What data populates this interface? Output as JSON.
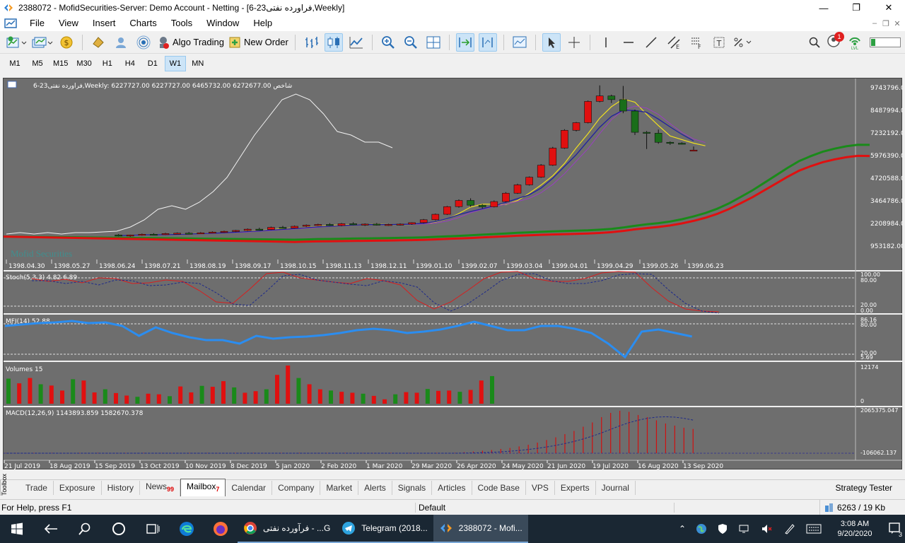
{
  "window": {
    "title": "2388072 - MofidSecurities-Server: Demo Account - Netting - [فراورده نفتی23-6,Weekly]"
  },
  "menu": [
    "File",
    "View",
    "Insert",
    "Charts",
    "Tools",
    "Window",
    "Help"
  ],
  "toolbar": {
    "algo_trading": "Algo Trading",
    "new_order": "New Order",
    "notifications": "1"
  },
  "timeframes": {
    "items": [
      "M1",
      "M5",
      "M15",
      "M30",
      "H1",
      "H4",
      "D1",
      "W1",
      "MN"
    ],
    "selected": "W1"
  },
  "chart": {
    "header": "فراورده نفتی23-6,Weekly:  6227727.00 6227727.00 6465732.00 6272677.00  شاخص",
    "watermark": "Mofid Securities",
    "main_prices": [
      "9743796.00",
      "8487994.00",
      "7232192.00",
      "5976390.00",
      "4720588.00",
      "3464786.00",
      "2208984.00",
      "953182.00"
    ],
    "main_dates": [
      "1398.04.30",
      "1398.05.27",
      "1398.06.24",
      "1398.07.21",
      "1398.08.19",
      "1398.09.17",
      "1398.10.15",
      "1398.11.13",
      "1398.12.11",
      "1399.01.10",
      "1399.02.07",
      "1399.03.04",
      "1399.04.01",
      "1399.04.29",
      "1399.05.26",
      "1399.06.23"
    ],
    "stoch_label": "Stoch(5,3,3) 4.82 6.89",
    "stoch_levels": [
      "100.00",
      "80.00",
      "20.00",
      "0.00"
    ],
    "mfi_label": "MFI(14) 52.88",
    "mfi_levels": [
      "86.16",
      "80.00",
      "20.00",
      "5.69"
    ],
    "vol_label": "Volumes 15",
    "vol_levels": [
      "12174",
      "0"
    ],
    "macd_label": "MACD(12,26,9) 1143893.859 1582670.378",
    "macd_levels": [
      "2065375.047",
      "-106062.137"
    ],
    "bottom_dates": [
      "21 Jul 2019",
      "18 Aug 2019",
      "15 Sep 2019",
      "13 Oct 2019",
      "10 Nov 2019",
      "8 Dec 2019",
      "5 Jan 2020",
      "2 Feb 2020",
      "1 Mar 2020",
      "29 Mar 2020",
      "26 Apr 2020",
      "24 May 2020",
      "21 Jun 2020",
      "19 Jul 2020",
      "16 Aug 2020",
      "13 Sep 2020"
    ]
  },
  "chart_data": {
    "type": "candlestick",
    "price_range": [
      953182,
      9743796
    ],
    "candles": [
      {
        "o": 1600000,
        "h": 1650000,
        "l": 1520000,
        "c": 1560000
      },
      {
        "o": 1560000,
        "h": 1620000,
        "l": 1500000,
        "c": 1600000
      },
      {
        "o": 1600000,
        "h": 1680000,
        "l": 1560000,
        "c": 1640000
      },
      {
        "o": 1640000,
        "h": 1700000,
        "l": 1600000,
        "c": 1620000
      },
      {
        "o": 1620000,
        "h": 1720000,
        "l": 1600000,
        "c": 1680000
      },
      {
        "o": 1680000,
        "h": 1740000,
        "l": 1650000,
        "c": 1700000
      },
      {
        "o": 1700000,
        "h": 1760000,
        "l": 1660000,
        "c": 1690000
      },
      {
        "o": 1690000,
        "h": 1760000,
        "l": 1660000,
        "c": 1720000
      },
      {
        "o": 1720000,
        "h": 1800000,
        "l": 1700000,
        "c": 1760000
      },
      {
        "o": 1760000,
        "h": 1840000,
        "l": 1720000,
        "c": 1800000
      },
      {
        "o": 1800000,
        "h": 1880000,
        "l": 1760000,
        "c": 1850000
      },
      {
        "o": 1850000,
        "h": 1960000,
        "l": 1820000,
        "c": 1920000
      },
      {
        "o": 1920000,
        "h": 2000000,
        "l": 1880000,
        "c": 1900000
      },
      {
        "o": 1900000,
        "h": 2060000,
        "l": 1880000,
        "c": 2020000
      },
      {
        "o": 2020000,
        "h": 2100000,
        "l": 1960000,
        "c": 1980000
      },
      {
        "o": 1980000,
        "h": 2120000,
        "l": 1960000,
        "c": 2080000
      },
      {
        "o": 2080000,
        "h": 2180000,
        "l": 2040000,
        "c": 2140000
      },
      {
        "o": 2140000,
        "h": 2220000,
        "l": 2100000,
        "c": 2180000
      },
      {
        "o": 2180000,
        "h": 2250000,
        "l": 2100000,
        "c": 2120000
      },
      {
        "o": 2120000,
        "h": 2260000,
        "l": 2080000,
        "c": 2220000
      },
      {
        "o": 2220000,
        "h": 2300000,
        "l": 2140000,
        "c": 2160000
      },
      {
        "o": 2160000,
        "h": 2240000,
        "l": 2100000,
        "c": 2200000
      },
      {
        "o": 2200000,
        "h": 2260000,
        "l": 2120000,
        "c": 2160000
      },
      {
        "o": 2160000,
        "h": 2220000,
        "l": 2100000,
        "c": 2180000
      },
      {
        "o": 2180000,
        "h": 2240000,
        "l": 2120000,
        "c": 2200000
      },
      {
        "o": 2200000,
        "h": 2300000,
        "l": 2160000,
        "c": 2280000
      },
      {
        "o": 2280000,
        "h": 2480000,
        "l": 2240000,
        "c": 2440000
      },
      {
        "o": 2440000,
        "h": 2780000,
        "l": 2400000,
        "c": 2740000
      },
      {
        "o": 2740000,
        "h": 3200000,
        "l": 2700000,
        "c": 3160000
      },
      {
        "o": 3160000,
        "h": 3560000,
        "l": 3100000,
        "c": 3500000
      },
      {
        "o": 3500000,
        "h": 3620000,
        "l": 3150000,
        "c": 3240000
      },
      {
        "o": 3240000,
        "h": 3300000,
        "l": 3060000,
        "c": 3150000
      },
      {
        "o": 3150000,
        "h": 3500000,
        "l": 3120000,
        "c": 3440000
      },
      {
        "o": 3440000,
        "h": 3960000,
        "l": 3400000,
        "c": 3900000
      },
      {
        "o": 3900000,
        "h": 4420000,
        "l": 3860000,
        "c": 4360000
      },
      {
        "o": 4360000,
        "h": 4820000,
        "l": 4320000,
        "c": 4780000
      },
      {
        "o": 4780000,
        "h": 5500000,
        "l": 4740000,
        "c": 5440000
      },
      {
        "o": 5440000,
        "h": 6450000,
        "l": 5400000,
        "c": 6380000
      },
      {
        "o": 6380000,
        "h": 7420000,
        "l": 6340000,
        "c": 7360000
      },
      {
        "o": 7360000,
        "h": 7820000,
        "l": 7300000,
        "c": 7780000
      },
      {
        "o": 7780000,
        "h": 9000000,
        "l": 7740000,
        "c": 8950000
      },
      {
        "o": 8950000,
        "h": 9830000,
        "l": 8900000,
        "c": 9250000
      },
      {
        "o": 9250000,
        "h": 9320000,
        "l": 8860000,
        "c": 9050000
      },
      {
        "o": 9050000,
        "h": 9800000,
        "l": 8300000,
        "c": 8420000
      },
      {
        "o": 8420000,
        "h": 8500000,
        "l": 7100000,
        "c": 7250000
      },
      {
        "o": 7250000,
        "h": 7320000,
        "l": 6330000,
        "c": 7200000
      },
      {
        "o": 7200000,
        "h": 7400000,
        "l": 6620000,
        "c": 6700000
      },
      {
        "o": 6700000,
        "h": 6750000,
        "l": 6560000,
        "c": 6650000
      },
      {
        "o": 6650000,
        "h": 6700000,
        "l": 6580000,
        "c": 6600000
      },
      {
        "o": 6227727,
        "h": 6465732,
        "l": 6227727,
        "c": 6272677
      }
    ],
    "volumes": [
      8000,
      6500,
      8200,
      6200,
      5800,
      4200,
      7800,
      7400,
      3600,
      4600,
      3400,
      2600,
      2200,
      3200,
      3000,
      2400,
      5500,
      3600,
      5700,
      5400,
      7200,
      5200,
      3500,
      4000,
      4600,
      9200,
      12174,
      8200,
      6200,
      4600,
      4200,
      3800,
      3500,
      3200,
      2500,
      1400,
      3000,
      3700,
      3500,
      4700,
      4100,
      4200,
      3800,
      4400,
      7400,
      8800
    ],
    "macd_hist": [
      0,
      0,
      0,
      0,
      0,
      0,
      0,
      0,
      0,
      0,
      0,
      0,
      0,
      0,
      0,
      0,
      0,
      0,
      0,
      0,
      0,
      0,
      0,
      0,
      0,
      0,
      0,
      0,
      0,
      0,
      0,
      0,
      0,
      0,
      0,
      0,
      0,
      0,
      0,
      0,
      0,
      0,
      0,
      0,
      0,
      0,
      0,
      0,
      0,
      0,
      50000,
      80000,
      120000,
      150000,
      200000,
      250000,
      320000,
      400000,
      500000,
      620000,
      750000,
      900000,
      1050000,
      1250000,
      1450000,
      1700000,
      1900000,
      2000000,
      1950000,
      1800000,
      1700000,
      1550000,
      1400000,
      1300000,
      1200000,
      1143894
    ]
  }
}
